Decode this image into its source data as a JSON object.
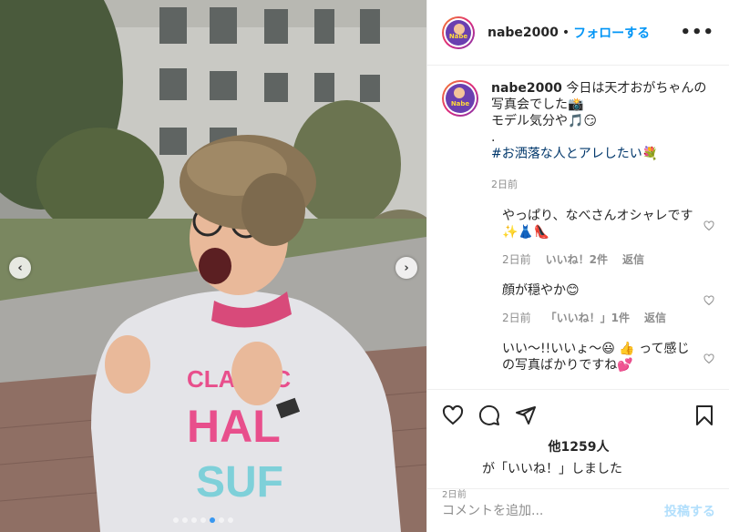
{
  "header": {
    "username": "nabe2000",
    "separator": "•",
    "follow_label": "フォローする",
    "more_label": "•••"
  },
  "avatar_text": "Nabe",
  "caption": {
    "username": "nabe2000",
    "line1": "今日は天才おがちゃんの写真会でした📸",
    "line2": "モデル気分や🎵😏",
    "line3": ".",
    "hashtag": "#お洒落な人とアレしたい💐",
    "time": "2日前"
  },
  "comments": [
    {
      "text": "やっぱり、なべさんオシャレです✨👗👠",
      "time": "2日前",
      "likes": "いいね！2件",
      "reply": "返信"
    },
    {
      "text": "顔が穏やか😊",
      "time": "2日前",
      "likes": "「いいね！」1件",
      "reply": "返信"
    },
    {
      "text": "いい〜!!いいょ〜😃 👍 って感じの写真ばかりですね💕",
      "time": "",
      "likes": "",
      "reply": ""
    }
  ],
  "likes_summary": {
    "count_text": "他1259人",
    "liked_text": "が「いいね！」しました",
    "time": "2日前"
  },
  "add_comment": {
    "placeholder": "コメントを追加...",
    "post_label": "投稿する"
  },
  "icons": [
    "heart-icon",
    "comment-icon",
    "share-icon",
    "bookmark-icon",
    "chevron-left-icon",
    "chevron-right-icon"
  ],
  "colors": {
    "link_blue": "#0095f6",
    "hashtag": "#00376b",
    "muted": "#8e8e8e",
    "post_disabled": "#b2dffc"
  },
  "carousel": {
    "slide_count": 7,
    "active_index": 4
  }
}
